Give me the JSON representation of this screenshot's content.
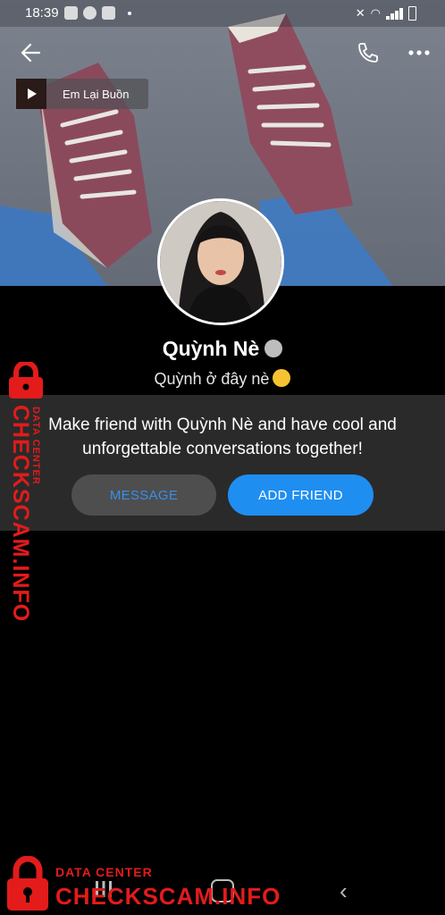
{
  "statusbar": {
    "time": "18:39"
  },
  "header": {
    "back_icon": "arrow-left-icon",
    "call_icon": "phone-icon",
    "more_icon": "more-dots-icon"
  },
  "music": {
    "title": "Em Lại Buồn",
    "icon": "play-icon"
  },
  "profile": {
    "name": "Quỳnh Nè",
    "status": "Quỳnh ở đây nè",
    "verified_icon": "edit-pencil-icon",
    "emoji": "kiss-emoji"
  },
  "friend_panel": {
    "message": "Make friend with Quỳnh Nè and have cool and unforgettable conversations together!",
    "message_button": "MESSAGE",
    "add_friend_button": "ADD FRIEND"
  },
  "watermark": {
    "line1": "DATA CENTER",
    "line2": "CHECKSCAM.INFO"
  },
  "colors": {
    "accent": "#1f8ef1",
    "watermark": "#e31b1b"
  }
}
